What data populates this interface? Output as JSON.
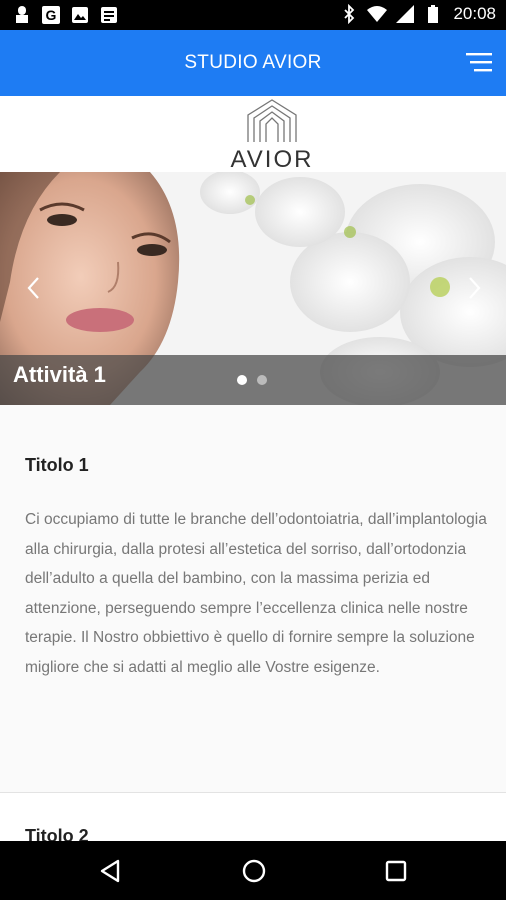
{
  "status_bar": {
    "time": "20:08",
    "left_icons": [
      "notification-icon",
      "g-app-icon",
      "image-icon",
      "news-icon"
    ],
    "right_icons": [
      "bluetooth-icon",
      "wifi-icon",
      "signal-icon",
      "battery-icon"
    ]
  },
  "app_bar": {
    "title": "STUDIO AVIOR",
    "menu_icon": "menu-icon",
    "color": "#1e7cf3"
  },
  "logo": {
    "text": "AVIOR"
  },
  "carousel": {
    "caption": "Attività 1",
    "slide_count": 2,
    "active_slide": 1,
    "prev_icon": "chevron-left-icon",
    "next_icon": "chevron-right-icon"
  },
  "sections": [
    {
      "title": "Titolo 1",
      "body": "Ci occupiamo di tutte le branche dell’odontoiatria, dall’implantologia alla chirurgia, dalla protesi all’estetica del sorriso, dall’ortodonzia dell’adulto a quella del bambino, con la massima perizia ed attenzione, perseguendo sempre l’eccellenza clinica nelle nostre terapie.   Il Nostro obbiettivo è quello di fornire sempre la soluzione migliore che si adatti al meglio alle Vostre esigenze."
    },
    {
      "title": "Titolo 2"
    }
  ],
  "nav_bar": {
    "icons": [
      "back-icon",
      "home-icon",
      "recent-apps-icon"
    ]
  }
}
